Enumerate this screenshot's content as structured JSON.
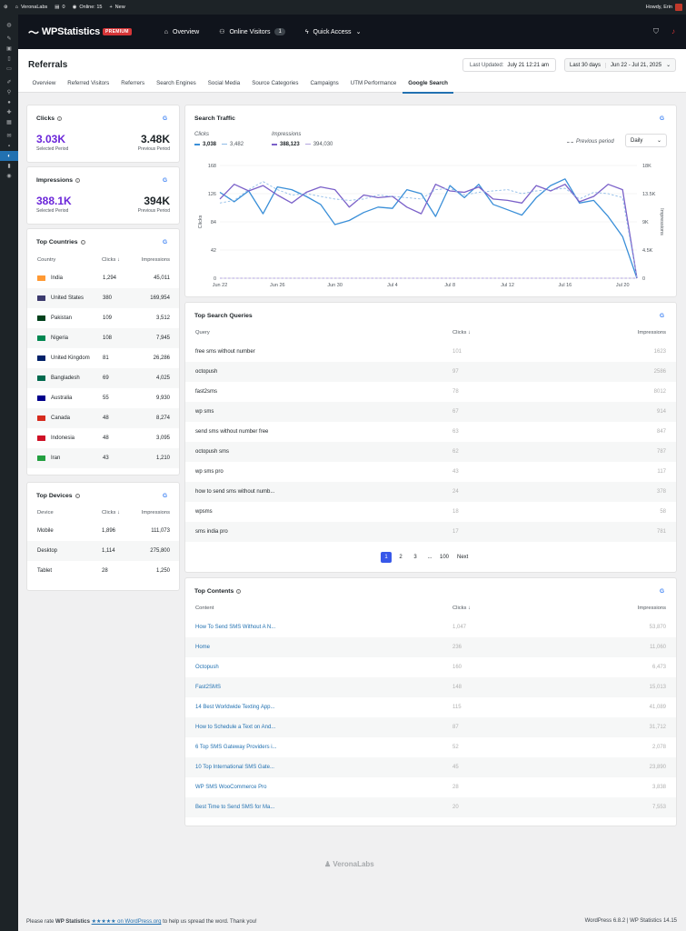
{
  "adminbar": {
    "site": "VeronaLabs",
    "comments": "0",
    "online": "Online: 15",
    "new": "New",
    "howdy": "Howdy, Erin"
  },
  "header": {
    "logo": "WPStatistics",
    "badge": "PREMIUM",
    "nav": [
      {
        "label": "Overview"
      },
      {
        "label": "Online Visitors",
        "count": "1"
      },
      {
        "label": "Quick Access"
      }
    ]
  },
  "page": {
    "title": "Referrals",
    "last_updated_label": "Last Updated:",
    "last_updated": "July 21 12:21 am",
    "range_label": "Last 30 days",
    "range": "Jun 22 - Jul 21, 2025"
  },
  "tabs": [
    "Overview",
    "Referred Visitors",
    "Referrers",
    "Search Engines",
    "Social Media",
    "Source Categories",
    "Campaigns",
    "UTM Performance",
    "Google Search"
  ],
  "clicks": {
    "title": "Clicks",
    "selected": "3.03K",
    "selected_label": "Selected Period",
    "previous": "3.48K",
    "previous_label": "Previous Period"
  },
  "impressions": {
    "title": "Impressions",
    "selected": "388.1K",
    "selected_label": "Selected Period",
    "previous": "394K",
    "previous_label": "Previous Period"
  },
  "countries": {
    "title": "Top Countries",
    "headers": [
      "Country",
      "Clicks ↓",
      "Impressions"
    ],
    "rows": [
      {
        "name": "India",
        "clicks": "1,294",
        "impr": "45,011",
        "color": "#ff9933"
      },
      {
        "name": "United States",
        "clicks": "380",
        "impr": "169,954",
        "color": "#3c3b6e"
      },
      {
        "name": "Pakistan",
        "clicks": "109",
        "impr": "3,512",
        "color": "#01411c"
      },
      {
        "name": "Nigeria",
        "clicks": "108",
        "impr": "7,945",
        "color": "#008751"
      },
      {
        "name": "United Kingdom",
        "clicks": "81",
        "impr": "26,286",
        "color": "#012169"
      },
      {
        "name": "Bangladesh",
        "clicks": "69",
        "impr": "4,025",
        "color": "#006a4e"
      },
      {
        "name": "Australia",
        "clicks": "55",
        "impr": "9,930",
        "color": "#00008b"
      },
      {
        "name": "Canada",
        "clicks": "48",
        "impr": "8,274",
        "color": "#d52b1e"
      },
      {
        "name": "Indonesia",
        "clicks": "48",
        "impr": "3,095",
        "color": "#ce1126"
      },
      {
        "name": "Iran",
        "clicks": "43",
        "impr": "1,210",
        "color": "#239f40"
      }
    ]
  },
  "devices": {
    "title": "Top Devices",
    "headers": [
      "Device",
      "Clicks ↓",
      "Impressions"
    ],
    "rows": [
      {
        "name": "Mobile",
        "clicks": "1,896",
        "impr": "111,073"
      },
      {
        "name": "Desktop",
        "clicks": "1,114",
        "impr": "275,800"
      },
      {
        "name": "Tablet",
        "clicks": "28",
        "impr": "1,250"
      }
    ]
  },
  "traffic": {
    "title": "Search Traffic",
    "clicks_label": "Clicks",
    "clicks_val": "3,038",
    "clicks_prev": "3,482",
    "impr_label": "Impressions",
    "impr_val": "388,123",
    "impr_prev": "394,030",
    "prev_legend": "Previous period",
    "interval": "Daily",
    "yleft_label": "Clicks",
    "yright_label": "Impressions"
  },
  "chart_data": {
    "type": "line",
    "x": [
      "Jun 22",
      "Jun 23",
      "Jun 24",
      "Jun 25",
      "Jun 26",
      "Jun 27",
      "Jun 28",
      "Jun 29",
      "Jun 30",
      "Jul 1",
      "Jul 2",
      "Jul 3",
      "Jul 4",
      "Jul 5",
      "Jul 6",
      "Jul 7",
      "Jul 8",
      "Jul 9",
      "Jul 10",
      "Jul 11",
      "Jul 12",
      "Jul 13",
      "Jul 14",
      "Jul 15",
      "Jul 16",
      "Jul 17",
      "Jul 18",
      "Jul 19",
      "Jul 20",
      "Jul 21"
    ],
    "xticks": [
      "Jun 22",
      "Jun 26",
      "Jun 30",
      "Jul 4",
      "Jul 8",
      "Jul 12",
      "Jul 16",
      "Jul 20"
    ],
    "yticks_left": [
      "0",
      "42",
      "84",
      "126",
      "168"
    ],
    "yticks_right": [
      "0",
      "4.5K",
      "9K",
      "13.5K",
      "18K"
    ],
    "ylim_left": [
      0,
      168
    ],
    "ylim_right": [
      0,
      18000
    ],
    "series": [
      {
        "name": "Clicks",
        "axis": "left",
        "color": "#3a8fd8",
        "values": [
          128,
          114,
          130,
          96,
          136,
          132,
          122,
          110,
          80,
          86,
          98,
          106,
          104,
          132,
          126,
          92,
          138,
          120,
          140,
          110,
          102,
          94,
          120,
          138,
          148,
          112,
          116,
          92,
          62,
          0
        ]
      },
      {
        "name": "Impressions",
        "axis": "left",
        "color": "#7b61c9",
        "values": [
          118,
          140,
          130,
          138,
          124,
          112,
          128,
          136,
          132,
          106,
          124,
          120,
          122,
          106,
          96,
          140,
          130,
          128,
          136,
          118,
          116,
          112,
          138,
          130,
          140,
          114,
          122,
          140,
          132,
          0
        ]
      },
      {
        "name": "Clicks previous",
        "axis": "left",
        "dashed": true,
        "color": "#8fbce8",
        "values": [
          112,
          116,
          132,
          144,
          132,
          124,
          126,
          122,
          118,
          116,
          118,
          124,
          122,
          120,
          118,
          132,
          134,
          124,
          128,
          130,
          132,
          126,
          130,
          132,
          134,
          118,
          128,
          126,
          120,
          0
        ]
      },
      {
        "name": "Impressions previous",
        "axis": "left",
        "dashed": true,
        "color": "#b3a6e0",
        "values": [
          0,
          0,
          0,
          0,
          0,
          0,
          0,
          0,
          0,
          0,
          0,
          0,
          0,
          0,
          0,
          0,
          0,
          0,
          0,
          0,
          0,
          0,
          0,
          0,
          0,
          0,
          0,
          0,
          0,
          0
        ]
      }
    ]
  },
  "queries": {
    "title": "Top Search Queries",
    "headers": [
      "Query",
      "Clicks ↓",
      "Impressions"
    ],
    "rows": [
      {
        "q": "free sms without number",
        "c": "101",
        "i": "1623"
      },
      {
        "q": "octopush",
        "c": "97",
        "i": "2586"
      },
      {
        "q": "fast2sms",
        "c": "78",
        "i": "8012"
      },
      {
        "q": "wp sms",
        "c": "67",
        "i": "914"
      },
      {
        "q": "send sms without number free",
        "c": "63",
        "i": "847"
      },
      {
        "q": "octopush sms",
        "c": "62",
        "i": "787"
      },
      {
        "q": "wp sms pro",
        "c": "43",
        "i": "117"
      },
      {
        "q": "how to send sms without numb...",
        "c": "24",
        "i": "378"
      },
      {
        "q": "wpsms",
        "c": "18",
        "i": "58"
      },
      {
        "q": "sms india pro",
        "c": "17",
        "i": "781"
      }
    ],
    "pages": [
      "1",
      "2",
      "3",
      "...",
      "100"
    ],
    "next": "Next"
  },
  "contents": {
    "title": "Top Contents",
    "headers": [
      "Content",
      "Clicks ↓",
      "Impressions"
    ],
    "rows": [
      {
        "t": "How To Send SMS Without A N...",
        "c": "1,047",
        "i": "53,870"
      },
      {
        "t": "Home",
        "c": "236",
        "i": "11,060"
      },
      {
        "t": "Octopush",
        "c": "160",
        "i": "6,473"
      },
      {
        "t": "Fast2SMS",
        "c": "148",
        "i": "15,013"
      },
      {
        "t": "14 Best Worldwide Texting App...",
        "c": "115",
        "i": "41,089"
      },
      {
        "t": "How to Schedule a Text on And...",
        "c": "87",
        "i": "31,712"
      },
      {
        "t": "6 Top SMS Gateway Providers i...",
        "c": "52",
        "i": "2,078"
      },
      {
        "t": "10 Top International SMS Gate...",
        "c": "45",
        "i": "23,890"
      },
      {
        "t": "WP SMS WooCommerce Pro",
        "c": "28",
        "i": "3,838"
      },
      {
        "t": "Best Time to Send SMS for Ma...",
        "c": "20",
        "i": "7,553"
      }
    ]
  },
  "brand": "VeronaLabs",
  "footer": {
    "pre": "Please rate ",
    "bold": "WP Statistics",
    "stars": "★★★★★ on WordPress.org",
    "post": " to help us spread the word. Thank you!",
    "right": "WordPress 6.8.2 | WP Statistics 14.15"
  }
}
